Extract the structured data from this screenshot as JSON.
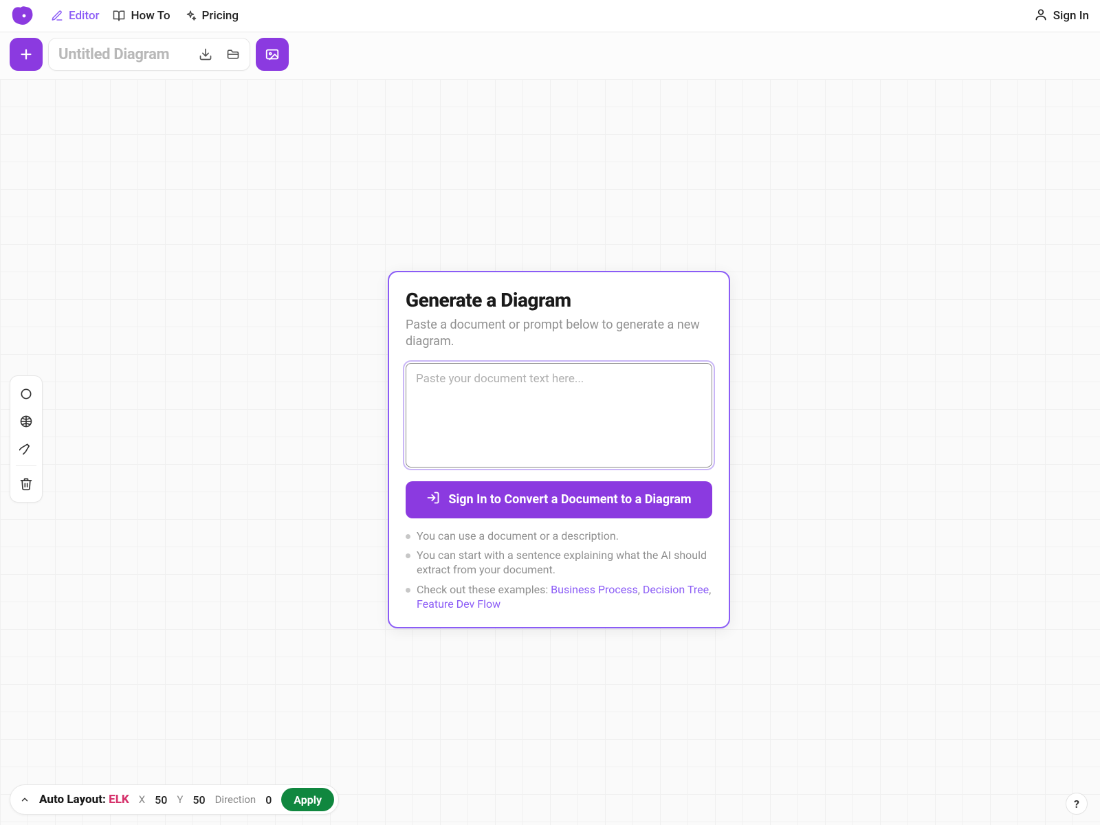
{
  "nav": {
    "editor": "Editor",
    "howto": "How To",
    "pricing": "Pricing",
    "signin": "Sign In"
  },
  "toolbar": {
    "title_placeholder": "Untitled Diagram"
  },
  "modal": {
    "title": "Generate a Diagram",
    "subtitle": "Paste a document or prompt below to generate a new diagram.",
    "textarea_placeholder": "Paste your document text here...",
    "cta_label": "Sign In to Convert a Document to a Diagram",
    "tip1": "You can use a document or a description.",
    "tip2": "You can start with a sentence explaining what the AI should extract from your document.",
    "tip3_prefix": "Check out these examples: ",
    "example1": "Business Process",
    "example2": "Decision Tree",
    "example3": "Feature Dev Flow"
  },
  "autolayout": {
    "label": "Auto Layout:",
    "engine": "ELK",
    "x_label": "X",
    "x_val": "50",
    "y_label": "Y",
    "y_val": "50",
    "dir_label": "Direction",
    "dir_val": "0",
    "apply": "Apply"
  },
  "help": "?"
}
